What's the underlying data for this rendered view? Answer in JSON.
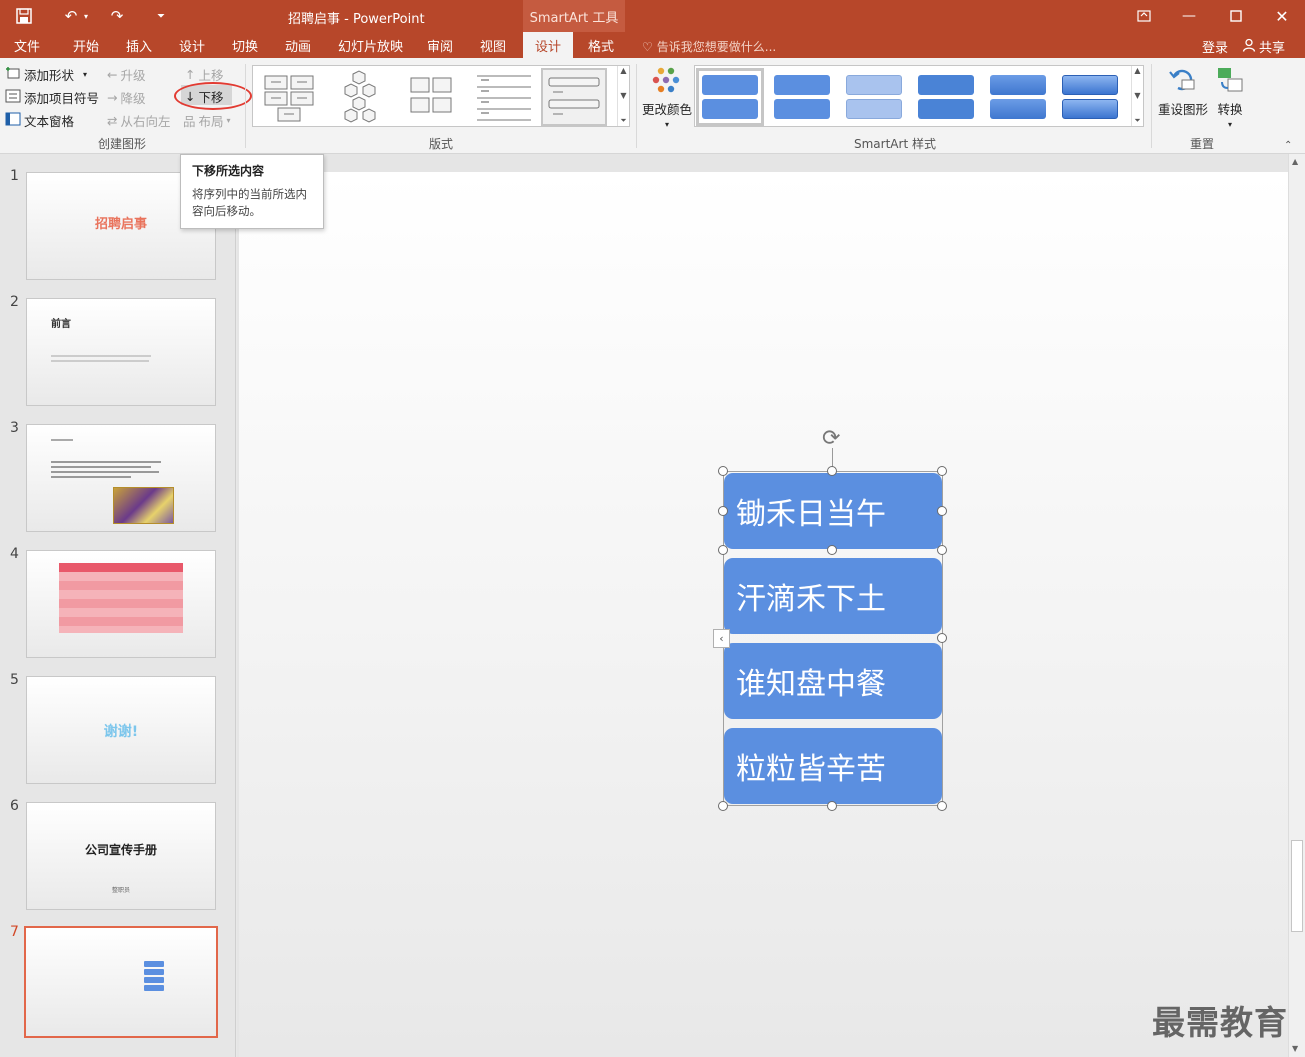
{
  "window": {
    "title": "招聘启事 - PowerPoint",
    "context_tab_header": "SmartArt 工具",
    "min_icon": "minimize-icon",
    "max_icon": "maximize-icon",
    "close_icon": "close-icon"
  },
  "quick_access": {
    "save_icon": "save-icon",
    "undo_icon": "undo-icon",
    "redo_icon": "redo-icon",
    "customize_icon": "customize-icon"
  },
  "tabs": [
    "文件",
    "开始",
    "插入",
    "设计",
    "切换",
    "动画",
    "幻灯片放映",
    "审阅",
    "视图",
    "设计",
    "格式"
  ],
  "active_tab_index": 9,
  "tell_me": "告诉我您想要做什么...",
  "account": {
    "login": "登录",
    "share": "共享"
  },
  "ribbon": {
    "create_graphic": {
      "label": "创建图形",
      "add_shape": "添加形状",
      "add_bullet": "添加项目符号",
      "text_pane": "文本窗格",
      "promote": "升级",
      "demote": "降级",
      "right_to_left": "从右向左",
      "move_up": "上移",
      "move_down": "下移",
      "layout": "布局"
    },
    "layouts": {
      "label": "版式"
    },
    "smartart_styles": {
      "label": "SmartArt 样式",
      "change_colors": "更改颜色"
    },
    "reset": {
      "label": "重置",
      "reset_graphic": "重设图形",
      "convert": "转换"
    }
  },
  "tooltip": {
    "title": "下移所选内容",
    "body": "将序列中的当前所选内容向后移动。"
  },
  "slides": [
    {
      "num": "1",
      "title": "招聘启事"
    },
    {
      "num": "2",
      "title": "前言"
    },
    {
      "num": "3",
      "title": ""
    },
    {
      "num": "4",
      "title": ""
    },
    {
      "num": "5",
      "title": "谢谢!"
    },
    {
      "num": "6",
      "title": "公司宣传手册",
      "subtitle": "整职员"
    },
    {
      "num": "7",
      "title": ""
    }
  ],
  "smartart": {
    "items": [
      "锄禾日当午",
      "汗滴禾下土",
      "谁知盘中餐",
      "粒粒皆辛苦"
    ],
    "box_color": "#5b8fe0"
  },
  "colors": {
    "accent": "#b7472a",
    "selection": "#e2674a",
    "highlight_ring": "#e23b32"
  },
  "watermark": "最需教育"
}
